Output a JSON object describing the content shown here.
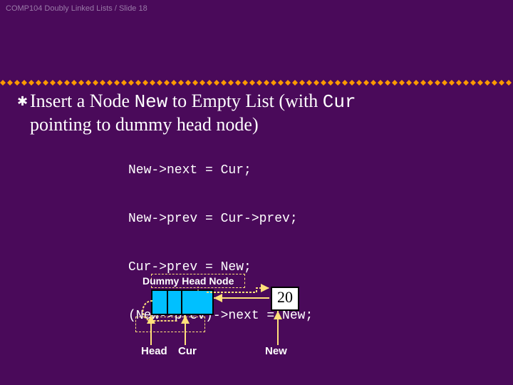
{
  "header": {
    "course_slide": "COMP104 Doubly Linked Lists / Slide 18"
  },
  "title": {
    "t1": "Insert a Node ",
    "mono1": "New",
    "t2": " to Empty List (with ",
    "mono2": "Cur",
    "t3": "pointing to dummy head node)"
  },
  "code": {
    "l1": "New->next = Cur;",
    "l2": "New->prev = Cur->prev;",
    "l3": "Cur->prev = New;",
    "l4": "(New->prev)->next = New;"
  },
  "diagram": {
    "dummy_label": "Dummy Head Node",
    "value": "20",
    "head": "Head",
    "cur": "Cur",
    "new": "New"
  }
}
